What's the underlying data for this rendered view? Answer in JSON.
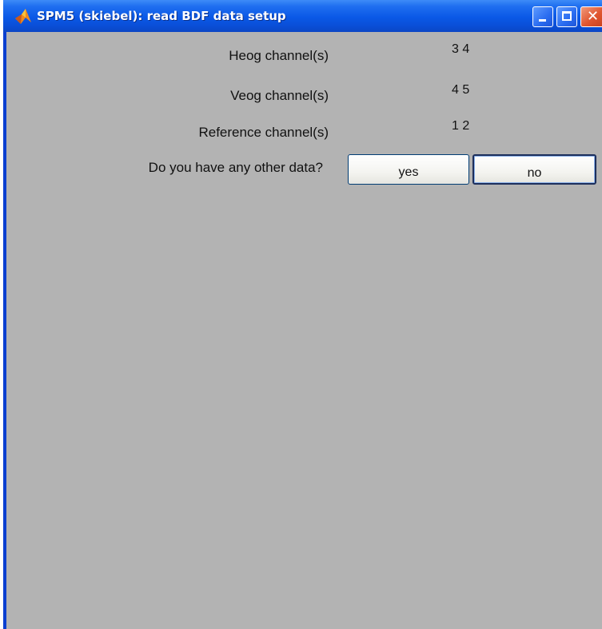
{
  "window": {
    "title": "SPM5 (skiebel): read BDF data setup",
    "icon": "matlab-icon",
    "controls": {
      "minimize_icon": "minimize-icon",
      "maximize_icon": "maximize-icon",
      "close_icon": "close-icon",
      "close_glyph": "✕"
    }
  },
  "form": {
    "rows": [
      {
        "label": "Heog channel(s)",
        "value": "3 4"
      },
      {
        "label": "Veog channel(s)",
        "value": "4 5"
      },
      {
        "label": "Reference channel(s)",
        "value": "1 2"
      }
    ],
    "question": {
      "label": "Do you have any other data?",
      "yes_label": "yes",
      "no_label": "no"
    }
  },
  "colors": {
    "titlebar": "#0a58e6",
    "background": "#b3b3b3",
    "close_button": "#e0552f"
  }
}
